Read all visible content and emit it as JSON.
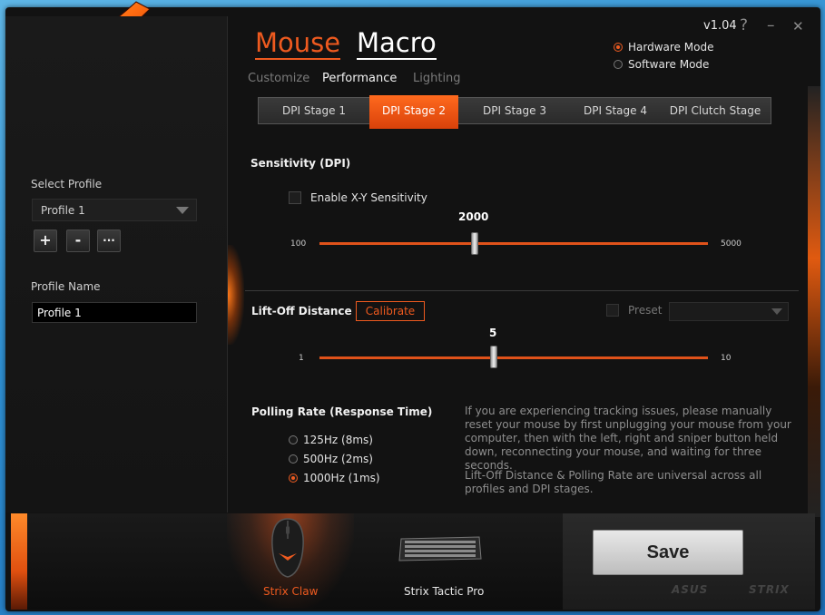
{
  "header": {
    "title_mouse": "Mouse",
    "title_macro": "Macro",
    "subtabs": [
      "Customize",
      "Performance",
      "Lighting"
    ],
    "version": "v1.04",
    "help_icon": "?",
    "minimize_icon": "–",
    "close_icon": "✕"
  },
  "mode": {
    "hardware": "Hardware Mode",
    "software": "Software Mode",
    "selected": "hardware"
  },
  "sidebar": {
    "select_profile_label": "Select Profile",
    "selected_profile": "Profile 1",
    "add_label": "+",
    "remove_label": "-",
    "more_label": "···",
    "profile_name_label": "Profile Name",
    "profile_name_value": "Profile 1"
  },
  "dpi_tabs": [
    "DPI Stage 1",
    "DPI Stage 2",
    "DPI Stage 3",
    "DPI Stage 4",
    "DPI Clutch Stage"
  ],
  "dpi_active_index": 1,
  "sensitivity": {
    "title": "Sensitivity (DPI)",
    "xy_label": "Enable X-Y Sensitivity",
    "value": "2000",
    "min": "100",
    "max": "5000"
  },
  "liftoff": {
    "title": "Lift-Off Distance",
    "calibrate": "Calibrate",
    "preset": "Preset",
    "value": "5",
    "min": "1",
    "max": "10"
  },
  "polling": {
    "title": "Polling Rate (Response Time)",
    "options": [
      "125Hz (8ms)",
      "500Hz (2ms)",
      "1000Hz (1ms)"
    ],
    "selected_index": 2
  },
  "info": {
    "p1": "If you are experiencing tracking issues, please manually reset your mouse by first unplugging your mouse from your computer, then with the left, right and sniper button held down, reconnecting your mouse, and waiting for three seconds.",
    "p2": "Lift-Off Distance & Polling Rate are universal across all profiles and DPI stages."
  },
  "devices": [
    "Strix Claw",
    "Strix Tactic Pro"
  ],
  "save_label": "Save",
  "brand": {
    "asus": "ASUS",
    "strix": "STRIX"
  },
  "colors": {
    "accent": "#ee5a1f",
    "inactive_tab": "#7a7a7a"
  }
}
